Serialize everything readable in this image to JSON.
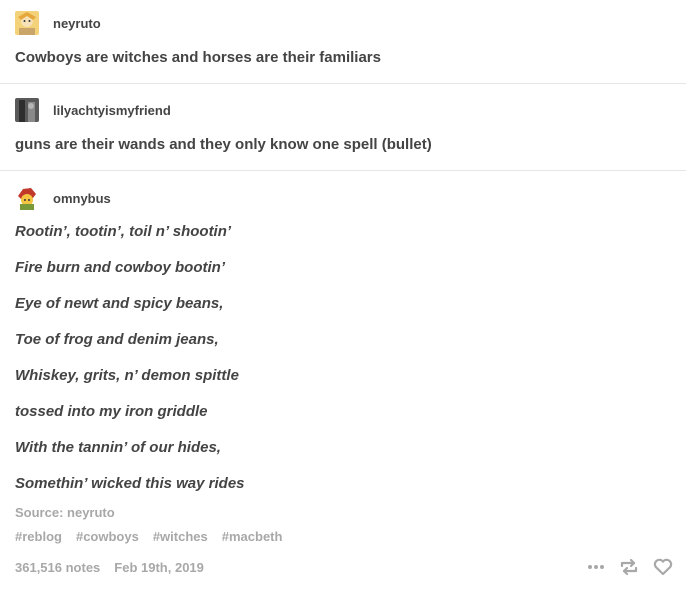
{
  "posts": [
    {
      "username": "neyruto",
      "text": "Cowboys are witches and horses are their familiars"
    },
    {
      "username": "lilyachtyismyfriend",
      "text": "guns are their wands and they only know one spell (bullet)"
    },
    {
      "username": "omnybus",
      "lines": [
        "Rootin’, tootin’, toil n’ shootin’",
        "Fire burn and cowboy bootin’",
        "Eye of newt and spicy beans,",
        "Toe of frog and denim jeans,",
        "Whiskey, grits, n’ demon spittle",
        "tossed into my iron griddle",
        "With the tannin’ of our hides,",
        "Somethin’ wicked this way rides"
      ]
    }
  ],
  "source": {
    "label": "Source:",
    "name": "neyruto"
  },
  "tags": [
    "#reblog",
    "#cowboys",
    "#witches",
    "#macbeth"
  ],
  "footer": {
    "notes": "361,516 notes",
    "date": "Feb 19th, 2019"
  },
  "icons": {
    "more": "more-icon",
    "reblog": "reblog-icon",
    "like": "heart-icon"
  },
  "colors": {
    "text": "#444444",
    "muted": "#a8a8a8",
    "divider": "#e6e6e6"
  }
}
